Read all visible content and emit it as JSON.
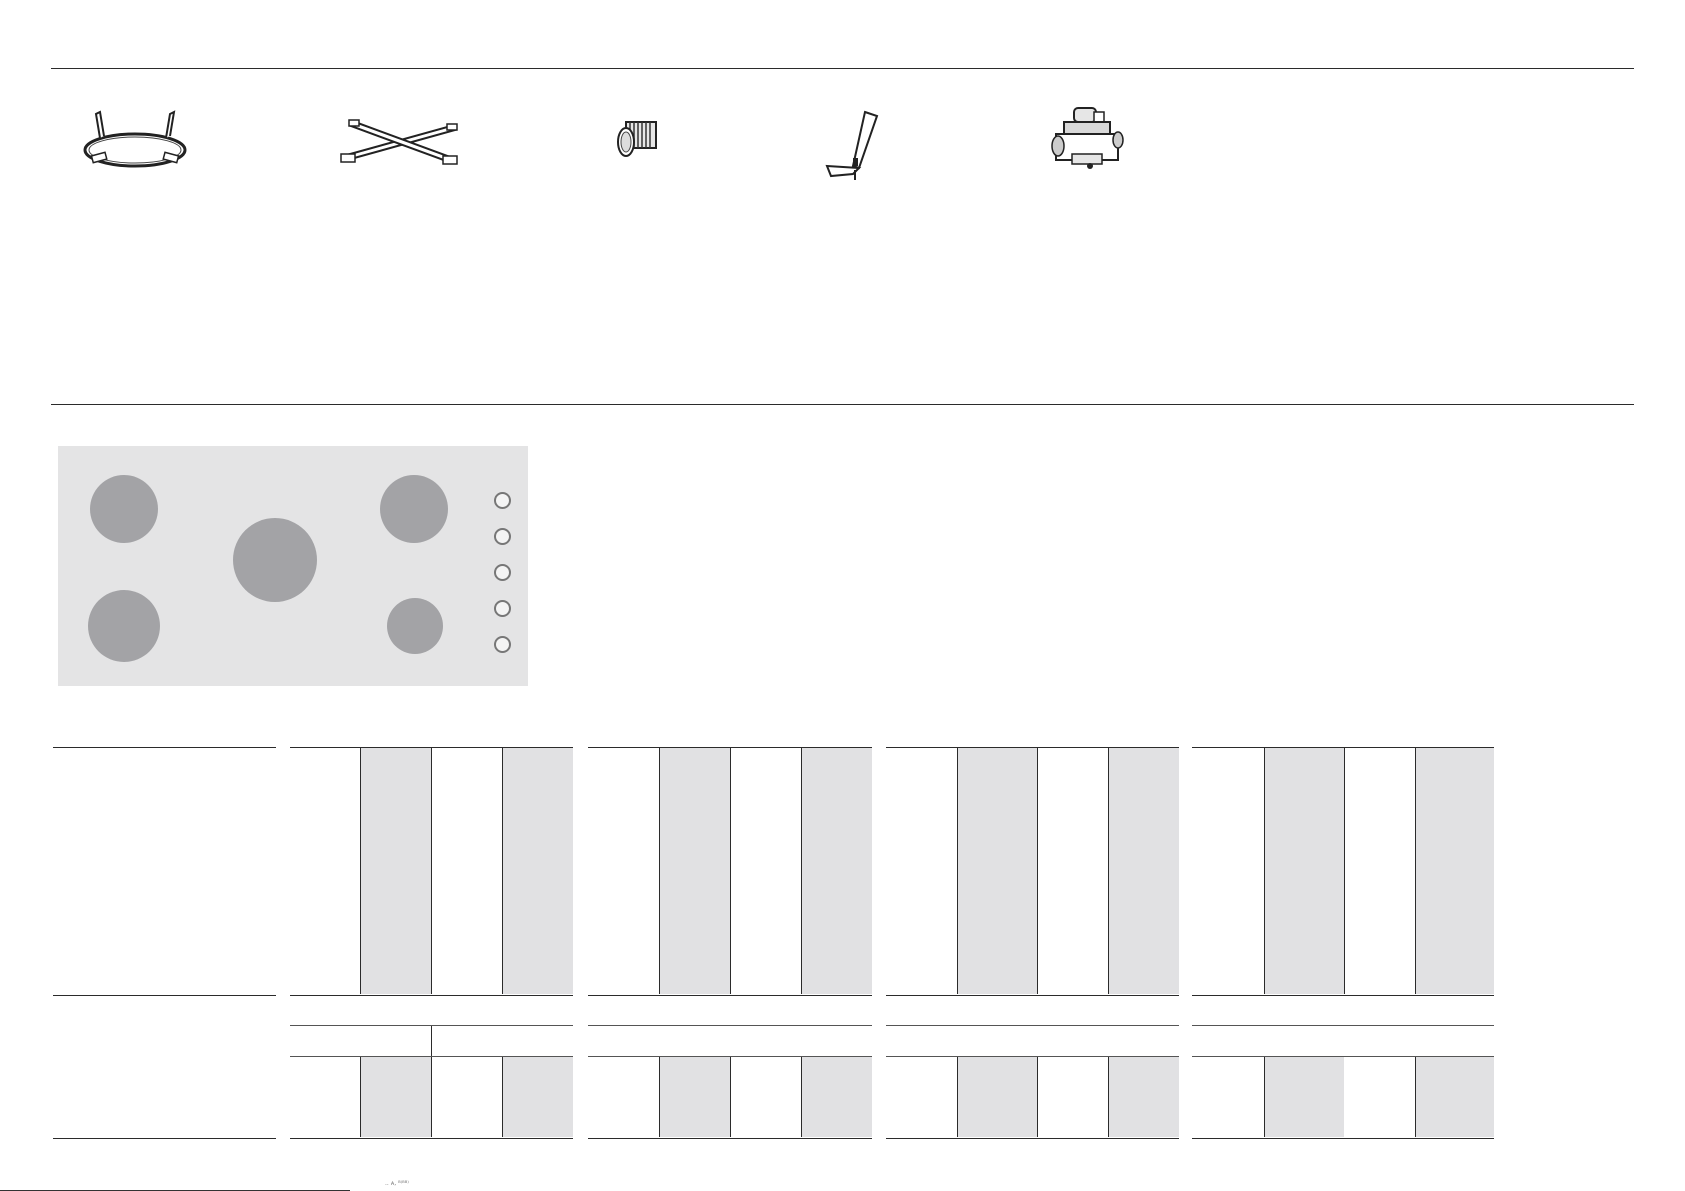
{
  "page": {
    "footer_mark": "..  ᴀ,  ᴮ⁽ᴮᴮ⁾"
  },
  "accessories": [
    {
      "icon": "wok-ring-icon"
    },
    {
      "icon": "grate-cross-icon"
    },
    {
      "icon": "threaded-connector-icon"
    },
    {
      "icon": "test-point-bracket-icon"
    },
    {
      "icon": "gas-regulator-icon"
    }
  ],
  "hob": {
    "burners": [
      "rear-left",
      "front-left",
      "center",
      "rear-right",
      "front-right"
    ],
    "knob_count": 5,
    "colors": {
      "panel": "#e4e4e5",
      "burner": "#a3a3a6",
      "knob_ring": "#777777"
    }
  },
  "table": {
    "groups": 4,
    "colors": {
      "shade": "#e1e1e3",
      "rule": "#2b2b2b"
    }
  }
}
